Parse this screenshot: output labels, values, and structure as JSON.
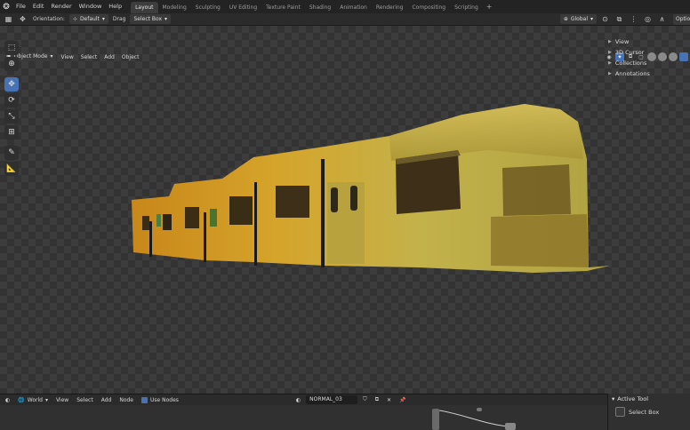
{
  "menu": {
    "logo_icon": "blender-logo-icon",
    "items": [
      "File",
      "Edit",
      "Render",
      "Window",
      "Help"
    ]
  },
  "workspaces": {
    "tabs": [
      "Layout",
      "Modeling",
      "Sculpting",
      "UV Editing",
      "Texture Paint",
      "Shading",
      "Animation",
      "Rendering",
      "Compositing",
      "Scripting"
    ],
    "active_index": 0,
    "add_label": "+"
  },
  "toolbar": {
    "orientation_label": "Orientation:",
    "orientation_value": "Default",
    "drag_label": "Drag",
    "drag_value": "Select Box",
    "transform_orientation": "Global",
    "options_label": "Option"
  },
  "viewport_header": {
    "mode": "Object Mode",
    "menus": [
      "View",
      "Select",
      "Add",
      "Object"
    ]
  },
  "npanel": {
    "sections": [
      "View",
      "3D Cursor",
      "Collections",
      "Annotations"
    ]
  },
  "node_editor": {
    "editor_type": "World",
    "menus": [
      "View",
      "Select",
      "Add",
      "Node"
    ],
    "use_nodes_label": "Use Nodes",
    "use_nodes": true,
    "world_name": "NORMAL_03"
  },
  "active_tool": {
    "header": "Active Tool",
    "tool_name": "Select Box"
  },
  "colors": {
    "accent": "#4772b3",
    "header_bg": "#232323",
    "viewport_bg": "#3c3c3c"
  }
}
